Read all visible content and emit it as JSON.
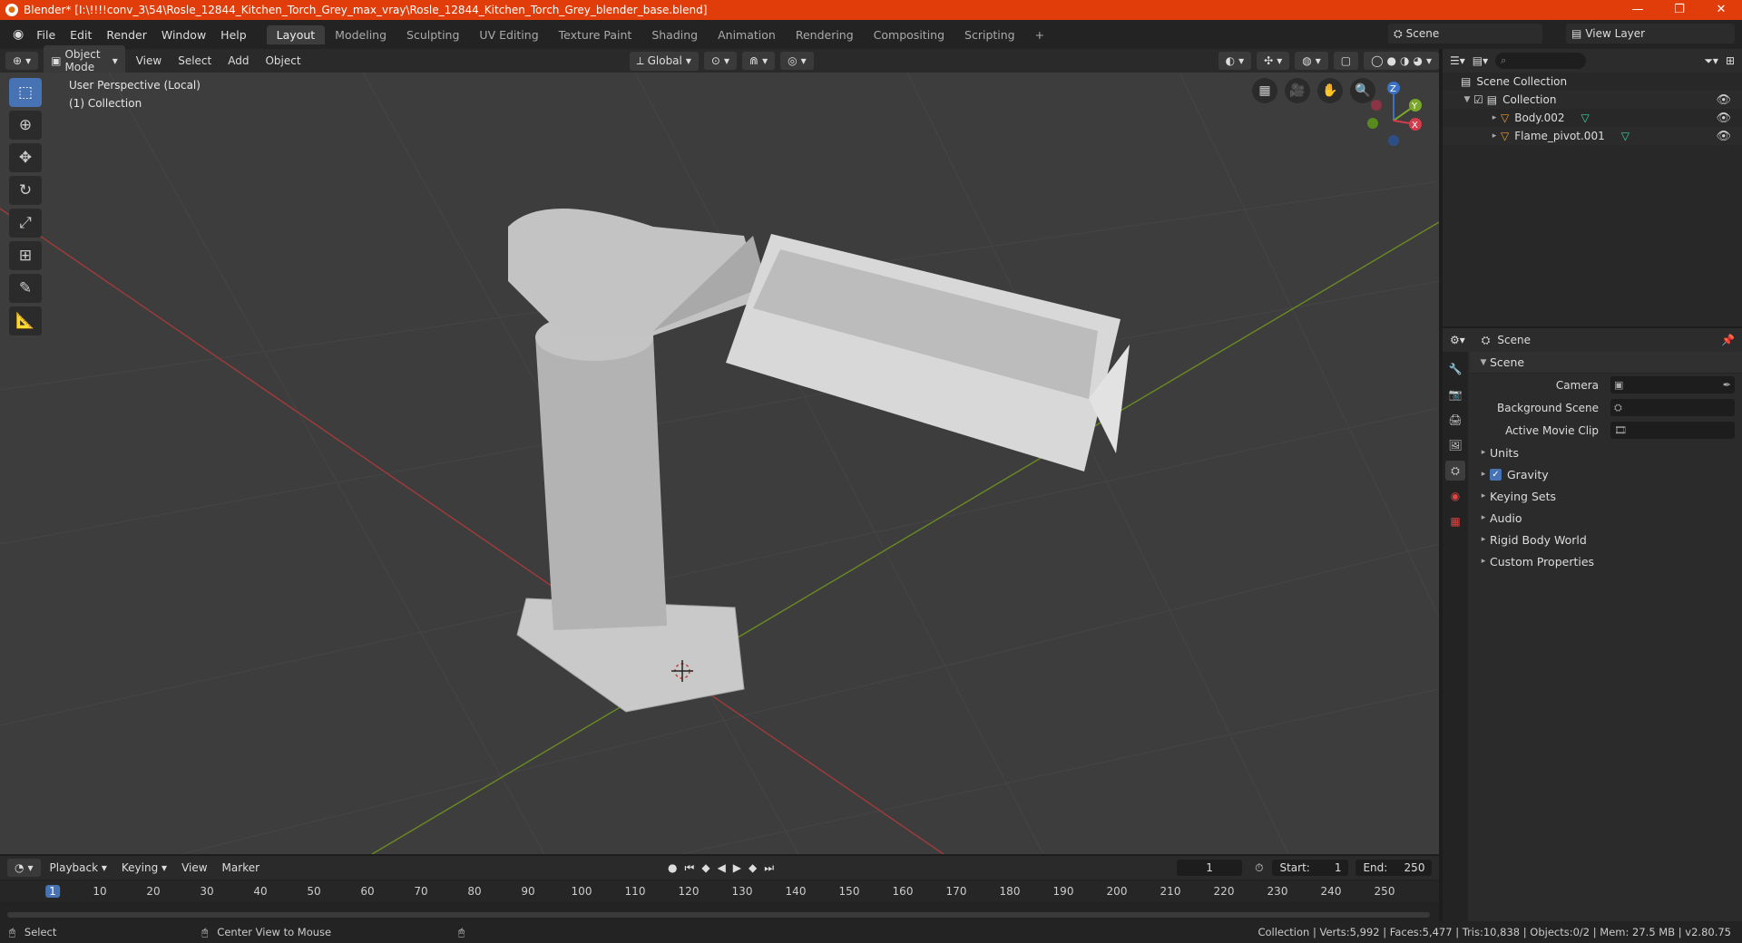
{
  "window": {
    "title": "Blender* [I:\\!!!!conv_3\\54\\Rosle_12844_Kitchen_Torch_Grey_max_vray\\Rosle_12844_Kitchen_Torch_Grey_blender_base.blend]",
    "minimize": "—",
    "maximize": "❐",
    "close": "✕"
  },
  "menu": [
    "File",
    "Edit",
    "Render",
    "Window",
    "Help"
  ],
  "workspaces": [
    "Layout",
    "Modeling",
    "Sculpting",
    "UV Editing",
    "Texture Paint",
    "Shading",
    "Animation",
    "Rendering",
    "Compositing",
    "Scripting"
  ],
  "add_workspace": "+",
  "scene": {
    "name": "Scene",
    "view_layer": "View Layer"
  },
  "viewport": {
    "mode": "Object Mode",
    "menu": [
      "View",
      "Select",
      "Add",
      "Object"
    ],
    "orientation": "Global",
    "info_line1": "User Perspective (Local)",
    "info_line2": "(1) Collection",
    "gizmo": {
      "x": "X",
      "y": "Y",
      "z": "Z"
    }
  },
  "outliner": {
    "root": "Scene Collection",
    "collection": "Collection",
    "items": [
      "Body.002",
      "Flame_pivot.001"
    ]
  },
  "properties": {
    "header": "Scene",
    "section": "Scene",
    "fields": [
      {
        "label": "Camera"
      },
      {
        "label": "Background Scene"
      },
      {
        "label": "Active Movie Clip"
      }
    ],
    "subsections": [
      "Units",
      "Gravity",
      "Keying Sets",
      "Audio",
      "Rigid Body World",
      "Custom Properties"
    ]
  },
  "timeline": {
    "menu": [
      "Playback",
      "Keying",
      "View",
      "Marker"
    ],
    "current_frame": "1",
    "start_label": "Start:",
    "start": "1",
    "end_label": "End:",
    "end": "250",
    "ticks": [
      "1",
      "10",
      "20",
      "30",
      "40",
      "50",
      "60",
      "70",
      "80",
      "90",
      "100",
      "110",
      "120",
      "130",
      "140",
      "150",
      "160",
      "170",
      "180",
      "190",
      "200",
      "210",
      "220",
      "230",
      "240",
      "250"
    ]
  },
  "status": {
    "select": "Select",
    "center": "Center View to Mouse",
    "stats": "Collection | Verts:5,992 | Faces:5,477 | Tris:10,838 | Objects:0/2 | Mem: 27.5 MB | v2.80.75"
  }
}
